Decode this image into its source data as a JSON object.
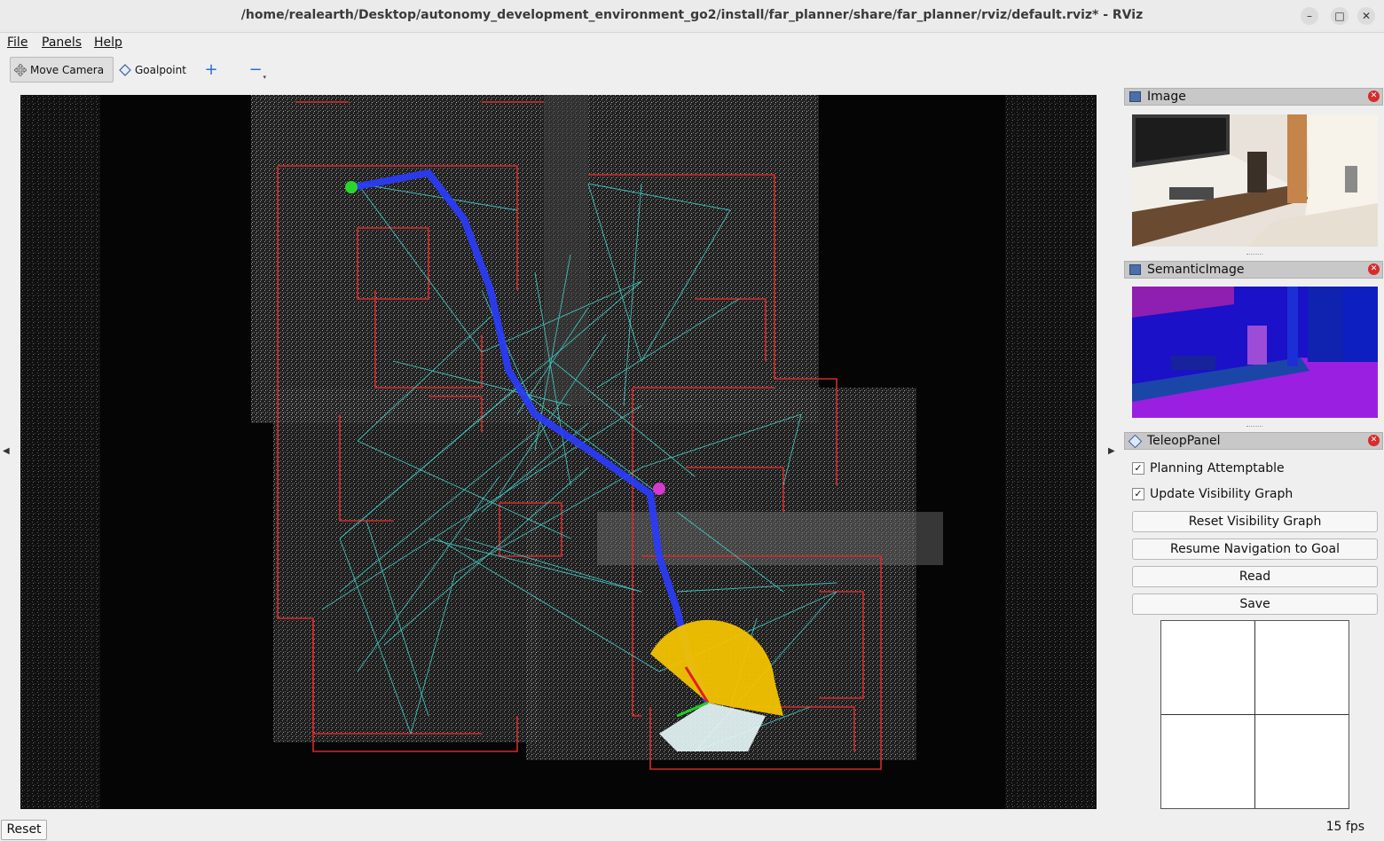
{
  "window": {
    "title": "/home/realearth/Desktop/autonomy_development_environment_go2/install/far_planner/share/far_planner/rviz/default.rviz* - RViz",
    "controls": [
      "–",
      "□",
      "✕"
    ]
  },
  "menu": {
    "items": [
      "File",
      "Panels",
      "Help"
    ]
  },
  "toolbar": {
    "move_camera": "Move Camera",
    "goalpoint": "Goalpoint",
    "zoom_in": "+",
    "zoom_out": "−"
  },
  "panels": {
    "image": {
      "title": "Image"
    },
    "semantic": {
      "title": "SemanticImage"
    },
    "teleop": {
      "title": "TeleopPanel",
      "checkboxes": [
        {
          "label": "Planning Attemptable",
          "checked": true
        },
        {
          "label": "Update Visibility Graph",
          "checked": true
        }
      ],
      "buttons": [
        "Reset Visibility Graph",
        "Resume Navigation to Goal",
        "Read",
        "Save"
      ]
    }
  },
  "status": {
    "reset_label": "Reset",
    "fps": "15 fps"
  },
  "colors": {
    "path": "#2a3cff",
    "graph": "#3fd6cf",
    "boundary": "#d42a2a",
    "cloud": "#8a8a8a",
    "robot_fov": "#f2c300",
    "goal": "#d33ad0",
    "start": "#2bd62b",
    "semantic_wall": "#1a11c8",
    "semantic_floor": "#9b1fe0"
  },
  "icons": {
    "move_camera": "move-camera-icon",
    "goalpoint": "goalpoint-diamond-icon",
    "image_panel": "image-panel-icon",
    "teleop_panel": "teleop-diamond-icon",
    "close": "close-icon"
  }
}
